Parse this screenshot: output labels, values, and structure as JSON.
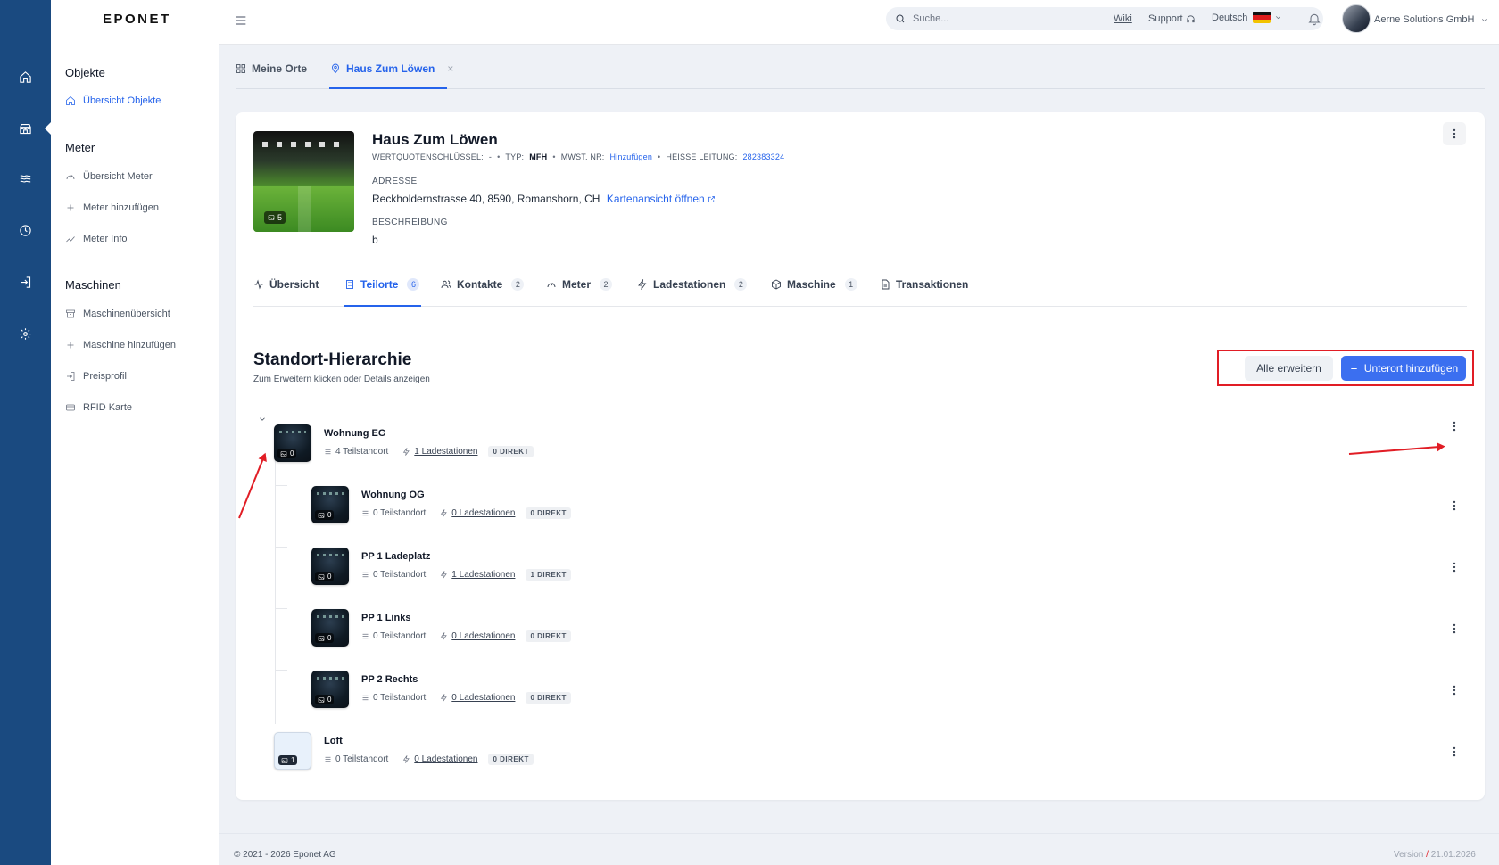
{
  "brand": {
    "logo": "EPONET"
  },
  "rail": {
    "icons": [
      "home-icon",
      "store-icon",
      "waves-icon",
      "clock-icon",
      "login-icon",
      "gear-icon"
    ]
  },
  "sidebar": {
    "sections": [
      {
        "title": "Objekte",
        "items": [
          {
            "label": "Übersicht Objekte",
            "icon": "home-icon",
            "active": true
          }
        ]
      },
      {
        "title": "Meter",
        "items": [
          {
            "label": "Übersicht Meter",
            "icon": "gauge-icon"
          },
          {
            "label": "Meter hinzufügen",
            "icon": "plus-icon"
          },
          {
            "label": "Meter Info",
            "icon": "trend-icon"
          }
        ]
      },
      {
        "title": "Maschinen",
        "items": [
          {
            "label": "Maschinenübersicht",
            "icon": "archive-icon"
          },
          {
            "label": "Maschine hinzufügen",
            "icon": "plus-icon"
          },
          {
            "label": "Preisprofil",
            "icon": "login-icon"
          },
          {
            "label": "RFID Karte",
            "icon": "card-icon"
          }
        ]
      }
    ]
  },
  "topbar": {
    "search_placeholder": "Suche...",
    "wiki": "Wiki",
    "support": "Support",
    "language": "Deutsch",
    "company": "Aerne Solutions GmbH"
  },
  "page_tabs": [
    {
      "label": "Meine Orte",
      "icon": "grid-icon"
    },
    {
      "label": "Haus Zum Löwen",
      "icon": "pin-icon",
      "active": true,
      "close": "×"
    }
  ],
  "object": {
    "title": "Haus Zum Löwen",
    "image_count": "5",
    "meta": {
      "wq_label": "WERTQUOTENSCHLÜSSEL:",
      "wq_value": "-",
      "type_label": "TYP:",
      "type_value": "MFH",
      "mwst_label": "MWST. NR:",
      "mwst_link": "Hinzufügen",
      "heisse_label": "HEISSE LEITUNG:",
      "heisse_value": "282383324"
    },
    "address_label": "ADRESSE",
    "address": "Reckholdernstrasse 40, 8590, Romanshorn, CH",
    "map_link": "Kartenansicht öffnen",
    "description_label": "BESCHREIBUNG",
    "description": "b"
  },
  "content_tabs": [
    {
      "label": "Übersicht",
      "icon": "activity-icon"
    },
    {
      "label": "Teilorte",
      "icon": "building-icon",
      "count": "6",
      "active": true
    },
    {
      "label": "Kontakte",
      "icon": "users-icon",
      "count": "2"
    },
    {
      "label": "Meter",
      "icon": "gauge-icon",
      "count": "2"
    },
    {
      "label": "Ladestationen",
      "icon": "bolt-icon",
      "count": "2"
    },
    {
      "label": "Maschine",
      "icon": "box-icon",
      "count": "1"
    },
    {
      "label": "Transaktionen",
      "icon": "file-icon"
    }
  ],
  "hierarchy": {
    "title": "Standort-Hierarchie",
    "subtitle": "Zum Erweitern klicken oder Details anzeigen",
    "expand_all": "Alle erweitern",
    "add_sub": "Unterort hinzufügen",
    "rows": [
      {
        "name": "Wohnung EG",
        "images": "0",
        "teilstandort": "4 Teilstandort",
        "ladestationen": "1 Ladestationen",
        "direkt": "0 DIREKT",
        "level": 0,
        "expanded": true
      },
      {
        "name": "Wohnung OG",
        "images": "0",
        "teilstandort": "0 Teilstandort",
        "ladestationen": "0 Ladestationen",
        "direkt": "0 DIREKT",
        "level": 1
      },
      {
        "name": "PP 1 Ladeplatz",
        "images": "0",
        "teilstandort": "0 Teilstandort",
        "ladestationen": "1 Ladestationen",
        "direkt": "1 DIREKT",
        "level": 1
      },
      {
        "name": "PP 1 Links",
        "images": "0",
        "teilstandort": "0 Teilstandort",
        "ladestationen": "0 Ladestationen",
        "direkt": "0 DIREKT",
        "level": 1
      },
      {
        "name": "PP 2 Rechts",
        "images": "0",
        "teilstandort": "0 Teilstandort",
        "ladestationen": "0 Ladestationen",
        "direkt": "0 DIREKT",
        "level": 1
      },
      {
        "name": "Loft",
        "images": "1",
        "teilstandort": "0 Teilstandort",
        "ladestationen": "0 Ladestationen",
        "direkt": "0 DIREKT",
        "level": 0
      }
    ]
  },
  "footer": {
    "copyright": "© 2021 - 2026 Eponet AG",
    "version_label": "Version",
    "version_sep": "/",
    "version_date": "21.01.2026"
  },
  "colors": {
    "rail": "#1a4a80",
    "accent": "#2563eb",
    "primary_button": "#3b6ff0",
    "annotation": "#e11d25"
  }
}
